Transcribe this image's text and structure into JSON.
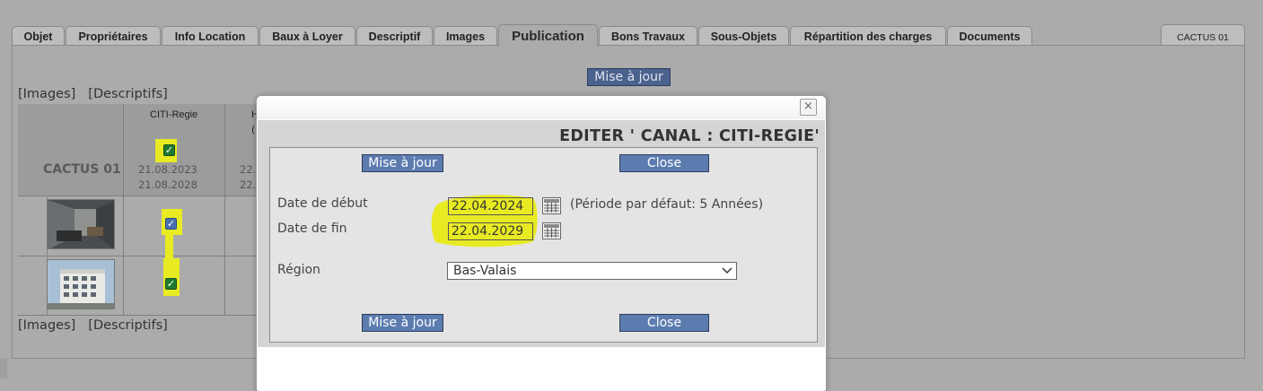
{
  "tabs": [
    {
      "label": "Objet"
    },
    {
      "label": "Propriétaires"
    },
    {
      "label": "Info Location"
    },
    {
      "label": "Baux à Loyer"
    },
    {
      "label": "Descriptif"
    },
    {
      "label": "Images"
    },
    {
      "label": "Publication"
    },
    {
      "label": "Bons Travaux"
    },
    {
      "label": "Sous-Objets"
    },
    {
      "label": "Répartition des charges"
    },
    {
      "label": "Documents"
    }
  ],
  "active_tab": "Publication",
  "object_tab_label": "CACTUS 01",
  "page": {
    "update_button": "Mise à jour",
    "links_top": [
      "[Images]",
      "[Descriptifs]"
    ],
    "links_bottom": [
      "[Images]",
      "[Descriptifs]"
    ],
    "table": {
      "object_name": "CACTUS 01",
      "channel_header": "CITI-Regie",
      "channel_start": "21.08.2023",
      "channel_end": "21.08.2028",
      "second_col_partial": {
        "header": "H",
        "header2": "(",
        "date1": "22.",
        "date2": "22."
      }
    }
  },
  "modal": {
    "close_x": "×",
    "title": "EDITER ' CANAL : CITI-REGIE'",
    "update_button": "Mise à jour",
    "close_button": "Close",
    "start_label": "Date de début",
    "start_value": "22.04.2024",
    "end_label": "Date de fin",
    "end_value": "22.04.2029",
    "default_period": "(Période par défaut: 5 Années)",
    "region_label": "Région",
    "region_value": "Bas-Valais"
  },
  "colors": {
    "background": "#ababab",
    "button": "#5c7cb0",
    "highlight": "#e8ea22",
    "checkbox_blue": "#4a6fb0",
    "checkbox_green": "#1f7a2f"
  },
  "icons": [
    "close-icon",
    "calendar-icon",
    "chevron-down-icon",
    "checkmark-icon"
  ]
}
